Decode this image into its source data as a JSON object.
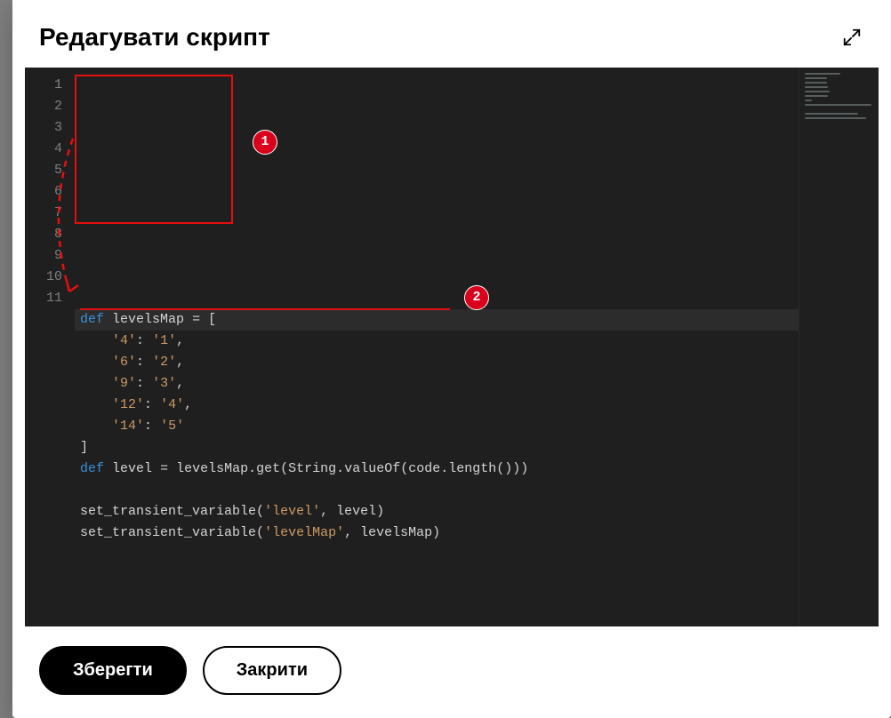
{
  "header": {
    "title": "Редагувати скрипт"
  },
  "editor": {
    "code_lines": [
      {
        "num": "1",
        "tokens": [
          [
            "kw",
            "def"
          ],
          [
            "sp",
            " "
          ],
          [
            "id",
            "levelsMap"
          ],
          [
            "sp",
            " "
          ],
          [
            "op",
            "="
          ],
          [
            "sp",
            " "
          ],
          [
            "pn",
            "["
          ]
        ],
        "current": true
      },
      {
        "num": "2",
        "tokens": [
          [
            "sp",
            "    "
          ],
          [
            "str",
            "'4'"
          ],
          [
            "pn",
            ":"
          ],
          [
            "sp",
            " "
          ],
          [
            "str",
            "'1'"
          ],
          [
            "pn",
            ","
          ]
        ]
      },
      {
        "num": "3",
        "tokens": [
          [
            "sp",
            "    "
          ],
          [
            "str",
            "'6'"
          ],
          [
            "pn",
            ":"
          ],
          [
            "sp",
            " "
          ],
          [
            "str",
            "'2'"
          ],
          [
            "pn",
            ","
          ]
        ]
      },
      {
        "num": "4",
        "tokens": [
          [
            "sp",
            "    "
          ],
          [
            "str",
            "'9'"
          ],
          [
            "pn",
            ":"
          ],
          [
            "sp",
            " "
          ],
          [
            "str",
            "'3'"
          ],
          [
            "pn",
            ","
          ]
        ]
      },
      {
        "num": "5",
        "tokens": [
          [
            "sp",
            "    "
          ],
          [
            "str",
            "'12'"
          ],
          [
            "pn",
            ":"
          ],
          [
            "sp",
            " "
          ],
          [
            "str",
            "'4'"
          ],
          [
            "pn",
            ","
          ]
        ]
      },
      {
        "num": "6",
        "tokens": [
          [
            "sp",
            "    "
          ],
          [
            "str",
            "'14'"
          ],
          [
            "pn",
            ":"
          ],
          [
            "sp",
            " "
          ],
          [
            "str",
            "'5'"
          ]
        ]
      },
      {
        "num": "7",
        "tokens": [
          [
            "pn",
            "]"
          ]
        ]
      },
      {
        "num": "8",
        "tokens": [
          [
            "kw",
            "def"
          ],
          [
            "sp",
            " "
          ],
          [
            "id",
            "level"
          ],
          [
            "sp",
            " "
          ],
          [
            "op",
            "="
          ],
          [
            "sp",
            " "
          ],
          [
            "id",
            "levelsMap"
          ],
          [
            "pn",
            "."
          ],
          [
            "fn",
            "get"
          ],
          [
            "pn",
            "("
          ],
          [
            "id",
            "String"
          ],
          [
            "pn",
            "."
          ],
          [
            "fn",
            "valueOf"
          ],
          [
            "pn",
            "("
          ],
          [
            "id",
            "code"
          ],
          [
            "pn",
            "."
          ],
          [
            "fn",
            "length"
          ],
          [
            "pn",
            "()))"
          ]
        ]
      },
      {
        "num": "9",
        "tokens": []
      },
      {
        "num": "10",
        "tokens": [
          [
            "fn",
            "set_transient_variable"
          ],
          [
            "pn",
            "("
          ],
          [
            "str",
            "'level'"
          ],
          [
            "pn",
            ","
          ],
          [
            "sp",
            " "
          ],
          [
            "id",
            "level"
          ],
          [
            "pn",
            ")"
          ]
        ]
      },
      {
        "num": "11",
        "tokens": [
          [
            "fn",
            "set_transient_variable"
          ],
          [
            "pn",
            "("
          ],
          [
            "str",
            "'levelMap'"
          ],
          [
            "pn",
            ","
          ],
          [
            "sp",
            " "
          ],
          [
            "id",
            "levelsMap"
          ],
          [
            "pn",
            ")"
          ]
        ]
      }
    ]
  },
  "annotations": {
    "badge1": "1",
    "badge2": "2"
  },
  "footer": {
    "save_label": "Зберегти",
    "close_label": "Закрити"
  }
}
